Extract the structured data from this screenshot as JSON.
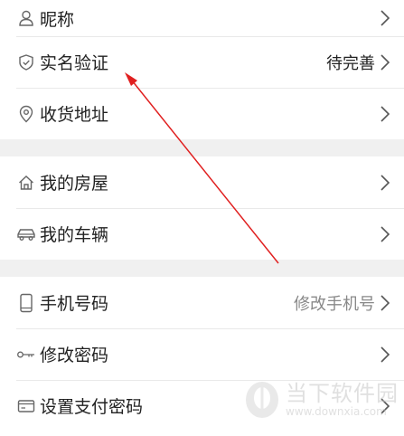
{
  "profile": {
    "nickname_label": "昵称",
    "realname_label": "实名验证",
    "realname_status": "待完善",
    "address_label": "收货地址"
  },
  "property": {
    "house_label": "我的房屋",
    "vehicle_label": "我的车辆"
  },
  "security": {
    "phone_label": "手机号码",
    "phone_action": "修改手机号",
    "password_label": "修改密码",
    "paypass_label": "设置支付密码"
  },
  "watermark": {
    "title": "当下软件园",
    "url": "www.downxia.com"
  },
  "colors": {
    "annotation_arrow": "#e02020",
    "separator": "#f0f0f0"
  }
}
